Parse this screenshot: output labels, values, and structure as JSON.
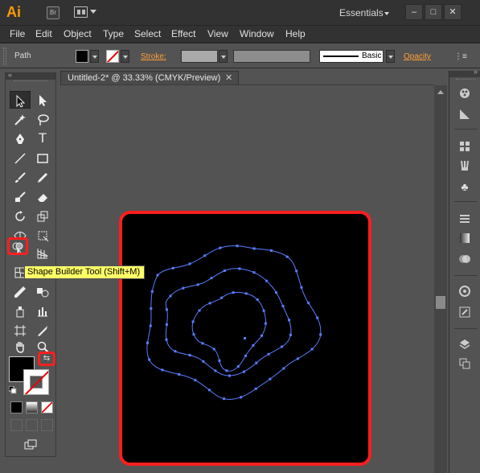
{
  "app": {
    "logo": "Ai",
    "bridge_label": "Br",
    "workspace": "Essentials",
    "window_controls": [
      "–",
      "□",
      "✕"
    ]
  },
  "menu": [
    "File",
    "Edit",
    "Object",
    "Type",
    "Select",
    "Effect",
    "View",
    "Window",
    "Help"
  ],
  "control_bar": {
    "selection_label": "Path",
    "stroke_label": "Stroke:",
    "brush_profile": "Basic",
    "opacity_label": "Opacity"
  },
  "document": {
    "tab_title": "Untitled-2* @ 33.33% (CMYK/Preview)",
    "close_glyph": "✕"
  },
  "tooltip": {
    "text": "Shape Builder Tool (Shift+M)"
  },
  "toolbox": {
    "type_tool_glyph": "T"
  },
  "colors": {
    "accent_orange": "#ff9a00",
    "highlight_red": "#ff1e1e",
    "path_blue": "#5b7dff",
    "tooltip_bg": "#ffff66"
  }
}
